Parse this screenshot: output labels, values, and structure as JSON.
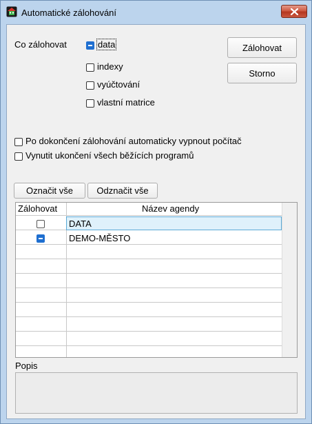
{
  "window": {
    "title": "Automatické zálohování"
  },
  "options": {
    "label": "Co zálohovat",
    "items": [
      {
        "label": "data",
        "checked": true
      },
      {
        "label": "indexy",
        "checked": false
      },
      {
        "label": "vyúčtování",
        "checked": false
      },
      {
        "label": "vlastní matrice",
        "checked": false
      }
    ]
  },
  "buttons": {
    "backup": "Zálohovat",
    "cancel": "Storno",
    "select_all": "Označit vše",
    "deselect_all": "Odznačit vše"
  },
  "extra_options": [
    {
      "label": "Po dokončení zálohování automaticky vypnout počítač",
      "checked": false
    },
    {
      "label": "Vynutit ukončení všech běžících programů",
      "checked": false
    }
  ],
  "table": {
    "columns": [
      "Zálohovat",
      "Název agendy"
    ],
    "rows": [
      {
        "checked": false,
        "name": "DATA"
      },
      {
        "checked": true,
        "name": "DEMO-MĚSTO"
      }
    ]
  },
  "description": {
    "label": "Popis"
  },
  "colors": {
    "accent": "#1f6fd0",
    "selection": "#dff1fb",
    "close_button": "#c9573f"
  }
}
